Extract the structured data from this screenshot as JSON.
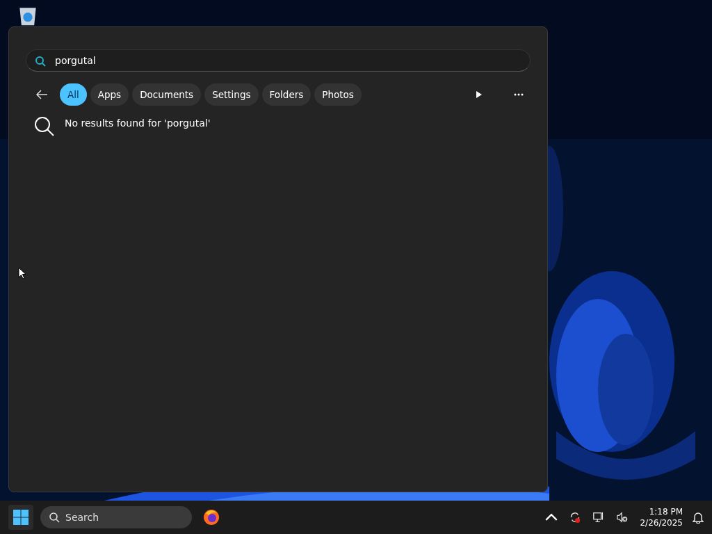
{
  "search_panel": {
    "query": "porgutal",
    "filters": [
      {
        "label": "All",
        "selected": true
      },
      {
        "label": "Apps",
        "selected": false
      },
      {
        "label": "Documents",
        "selected": false
      },
      {
        "label": "Settings",
        "selected": false
      },
      {
        "label": "Folders",
        "selected": false
      },
      {
        "label": "Photos",
        "selected": false
      }
    ],
    "message": "No results found for 'porgutal'"
  },
  "taskbar": {
    "search": {
      "placeholder": "Search"
    },
    "clock": {
      "time": "1:18 PM",
      "date": "2/26/2025"
    }
  }
}
